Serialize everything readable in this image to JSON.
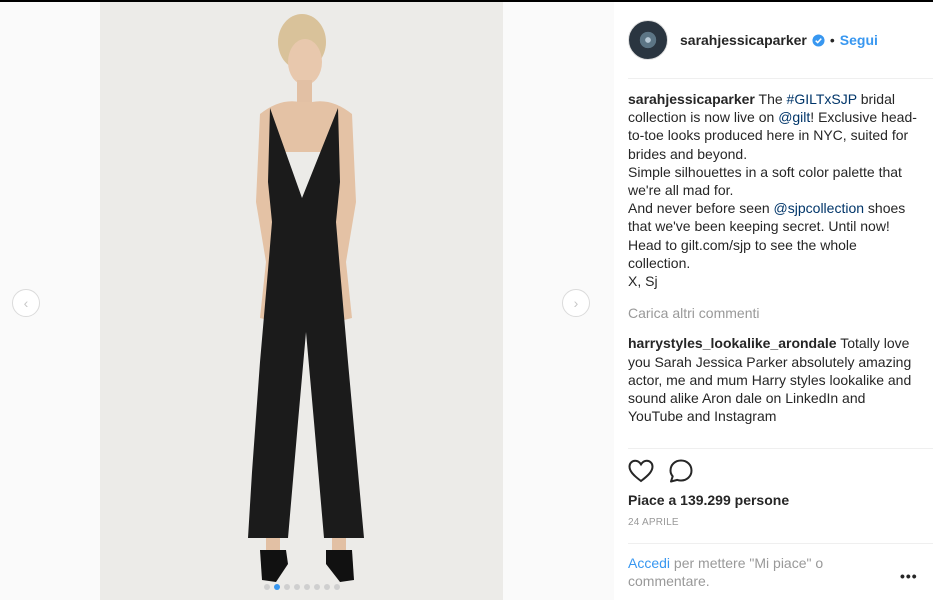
{
  "post": {
    "author": "sarahjessicaparker",
    "follow_label": "Segui",
    "bullet": "•",
    "caption": {
      "handle": "sarahjessicaparker",
      "t1": " The ",
      "tag": "#GILTxSJP",
      "t2": " bridal collection is now live on ",
      "mention1": "@gilt",
      "t3": "! Exclusive head-to-toe looks produced here in NYC, suited for brides and beyond.",
      "line2": "Simple silhouettes in a soft color palette that we're all mad for.",
      "t4": "And never before seen ",
      "mention2": "@sjpcollection",
      "t5": " shoes that we've been keeping secret. Until now!",
      "line4": "Head to gilt.com/sjp to see the whole collection.",
      "line5": "X, Sj"
    },
    "load_more": "Carica altri commenti",
    "comment": {
      "handle": "harrystyles_lookalike_arondale",
      "text": " Totally love you Sarah Jessica Parker absolutely amazing actor, me and mum Harry styles lookalike and sound alike Aron dale on LinkedIn and YouTube and Instagram"
    },
    "likes": "Piace a 139.299 persone",
    "date": "24 APRILE",
    "login_link": "Accedi",
    "login_text": " per mettere \"Mi piace\" o commentare.",
    "more_label": "•••"
  },
  "carousel": {
    "prev_icon": "‹",
    "next_icon": "›",
    "slide_count": 8,
    "active_slide": 1
  },
  "colors": {
    "accent": "#3897f0",
    "link": "#003569",
    "muted": "#999999"
  }
}
